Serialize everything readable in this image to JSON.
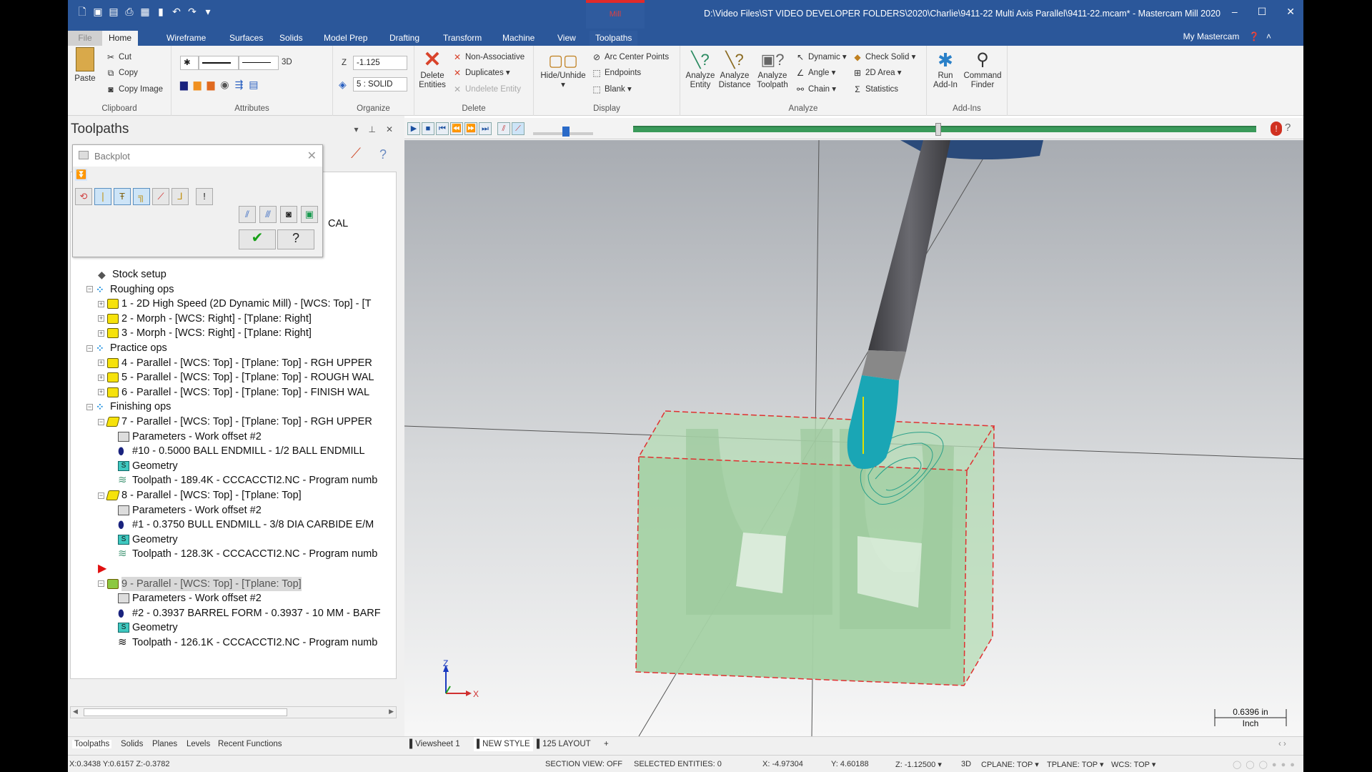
{
  "window": {
    "title": "D:\\Video Files\\ST VIDEO DEVELOPER FOLDERS\\2020\\Charlie\\9411-22 Multi Axis Parallel\\9411-22.mcam* - Mastercam Mill 2020",
    "context_tab": "Mill",
    "minimize": "‒",
    "maximize": "☐",
    "close": "✕"
  },
  "ribbon_tabs": [
    "File",
    "Home",
    "Wireframe",
    "Surfaces",
    "Solids",
    "Model Prep",
    "Drafting",
    "Transform",
    "Machine",
    "View",
    "Toolpaths"
  ],
  "my_mastercam": "My Mastercam",
  "ribbon": {
    "clipboard": {
      "label": "Clipboard",
      "paste": "Paste",
      "cut": "Cut",
      "copy": "Copy",
      "copy_image": "Copy Image"
    },
    "attributes": {
      "label": "Attributes",
      "three_d": "3D"
    },
    "organize": {
      "label": "Organize",
      "z_label": "Z",
      "z_value": "-1.125",
      "level": "5 : SOLID"
    },
    "delete": {
      "label": "Delete",
      "delete_entities": "Delete Entities",
      "non_associative": "Non-Associative",
      "duplicates": "Duplicates",
      "undelete": "Undelete Entity"
    },
    "display": {
      "label": "Display",
      "hide_unhide": "Hide/Unhide",
      "arc_center": "Arc Center Points",
      "endpoints": "Endpoints",
      "blank": "Blank"
    },
    "analyze": {
      "label": "Analyze",
      "entity": "Analyze Entity",
      "distance": "Analyze Distance",
      "toolpath": "Analyze Toolpath",
      "dynamic": "Dynamic",
      "angle": "Angle",
      "chain": "Chain",
      "check_solid": "Check Solid",
      "area_2d": "2D Area",
      "statistics": "Statistics"
    },
    "addins": {
      "label": "Add-Ins",
      "run": "Run Add-In",
      "finder": "Command Finder"
    }
  },
  "panel": {
    "title": "Toolpaths",
    "backplot_title": "Backplot",
    "partial_text": "CAL",
    "tree": [
      {
        "text": "Stock setup",
        "level": 2,
        "icon": "stock"
      },
      {
        "text": "Roughing ops",
        "level": 1,
        "icon": "group"
      },
      {
        "text": "1 - 2D High Speed (2D Dynamic Mill) - [WCS: Top] - [T",
        "level": 2,
        "icon": "folder"
      },
      {
        "text": "2 - Morph - [WCS: Right] - [Tplane: Right]",
        "level": 2,
        "icon": "folder"
      },
      {
        "text": "3 - Morph - [WCS: Right] - [Tplane: Right]",
        "level": 2,
        "icon": "folder"
      },
      {
        "text": "Practice ops",
        "level": 1,
        "icon": "group"
      },
      {
        "text": "4 - Parallel - [WCS: Top] - [Tplane: Top] - RGH UPPER",
        "level": 2,
        "icon": "folder"
      },
      {
        "text": "5 - Parallel - [WCS: Top] - [Tplane: Top] - ROUGH WAL",
        "level": 2,
        "icon": "folder"
      },
      {
        "text": "6 - Parallel - [WCS: Top] - [Tplane: Top] - FINISH WAL",
        "level": 2,
        "icon": "folder"
      },
      {
        "text": "Finishing ops",
        "level": 1,
        "icon": "group"
      },
      {
        "text": "7 - Parallel - [WCS: Top] - [Tplane: Top] - RGH UPPER",
        "level": 2,
        "icon": "open-folder"
      },
      {
        "text": "Parameters - Work offset #2",
        "level": 3,
        "icon": "params"
      },
      {
        "text": "#10 - 0.5000 BALL ENDMILL - 1/2 BALL ENDMILL",
        "level": 3,
        "icon": "tool"
      },
      {
        "text": "Geometry",
        "level": 3,
        "icon": "geometry"
      },
      {
        "text": "Toolpath - 189.4K - CCCACCTI2.NC - Program numb",
        "level": 3,
        "icon": "toolpath"
      },
      {
        "text": "8 - Parallel - [WCS: Top] - [Tplane: Top]",
        "level": 2,
        "icon": "open-folder"
      },
      {
        "text": "Parameters - Work offset #2",
        "level": 3,
        "icon": "params"
      },
      {
        "text": "#1 - 0.3750 BULL ENDMILL - 3/8 DIA CARBIDE E/M",
        "level": 3,
        "icon": "tool"
      },
      {
        "text": "Geometry",
        "level": 3,
        "icon": "geometry"
      },
      {
        "text": "Toolpath - 128.3K - CCCACCTI2.NC - Program numb",
        "level": 3,
        "icon": "toolpath"
      },
      {
        "text": "",
        "level": 2,
        "icon": "insert-arrow"
      },
      {
        "text": "9 - Parallel - [WCS: Top] - [Tplane: Top]",
        "level": 2,
        "icon": "open-folder-selected",
        "selected": true
      },
      {
        "text": "Parameters - Work offset #2",
        "level": 3,
        "icon": "params"
      },
      {
        "text": "#2 - 0.3937 BARREL FORM - 0.3937 - 10 MM - BARF",
        "level": 3,
        "icon": "tool"
      },
      {
        "text": "Geometry",
        "level": 3,
        "icon": "geometry"
      },
      {
        "text": "Toolpath - 126.1K - CCCACCTI2.NC - Program numb",
        "level": 3,
        "icon": "toolpath-dark"
      }
    ]
  },
  "backplot": {
    "progress_percent": 49,
    "speed_percent": 55
  },
  "viewport": {
    "gnomon_z": "Z",
    "gnomon_x": "X",
    "scale_value": "0.6396 in",
    "scale_unit": "Inch"
  },
  "bottom_tabs": [
    "Toolpaths",
    "Solids",
    "Planes",
    "Levels",
    "Recent Functions"
  ],
  "view_sheets": [
    "Viewsheet 1",
    "NEW STYLE",
    "125 LAYOUT",
    "+"
  ],
  "status": {
    "cursor": "X:0.3438  Y:0.6157  Z:-0.3782",
    "section_view": "SECTION VIEW: OFF",
    "selected": "SELECTED ENTITIES: 0",
    "x": "X:   -4.97304",
    "y": "Y:   4.60188",
    "z": "Z:   -1.12500",
    "mode": "3D",
    "cplane": "CPLANE: TOP",
    "tplane": "TPLANE: TOP",
    "wcs": "WCS: TOP"
  },
  "colors": {
    "title_blue": "#2b579a",
    "stock_green": "#a9d3a9",
    "tool_cyan": "#1aa6b5",
    "progress_green": "#3a9a5a"
  }
}
